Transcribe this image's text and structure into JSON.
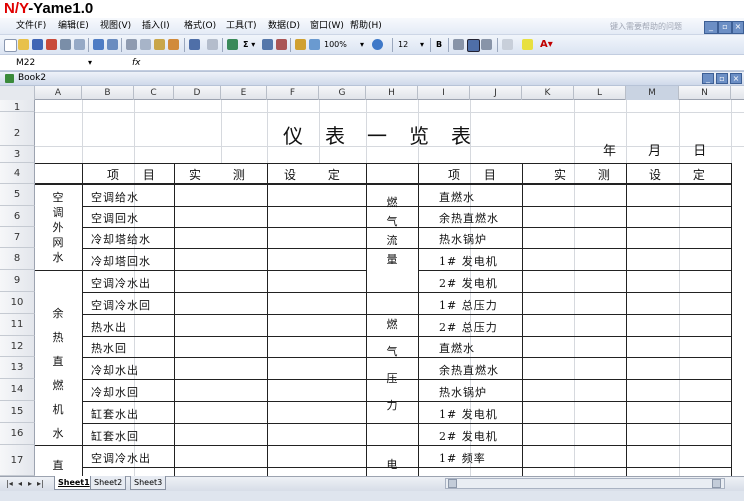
{
  "app": {
    "title_prefix": "N/Y",
    "title_suffix": "-Yame1.0"
  },
  "menu": {
    "items": [
      "文件(F)",
      "编辑(E)",
      "视图(V)",
      "插入(I)",
      "格式(O)",
      "工具(T)",
      "数据(D)",
      "窗口(W)",
      "帮助(H)"
    ],
    "help_placeholder": "键入需要帮助的问题"
  },
  "toolbar": {
    "zoom": "100%",
    "font_size": "12",
    "bold": "B"
  },
  "formula_bar": {
    "name_box": "M22",
    "fx": "fx"
  },
  "workbook": {
    "title": "Book2"
  },
  "columns": [
    "A",
    "B",
    "C",
    "D",
    "E",
    "F",
    "G",
    "H",
    "I",
    "J",
    "K",
    "L",
    "M",
    "N"
  ],
  "rows": [
    "1",
    "2",
    "3",
    "4",
    "5",
    "6",
    "7",
    "8",
    "9",
    "10",
    "11",
    "12",
    "13",
    "14",
    "15",
    "16",
    "17"
  ],
  "sheet": {
    "title": "仪表一览表",
    "date_label": "年 月 日",
    "headers": {
      "item": "项 目",
      "measured": "实 测",
      "setting": "设 定"
    },
    "left_groups": [
      {
        "label": "空调外网水",
        "items": [
          "空调给水",
          "空调回水",
          "冷却塔给水",
          "冷却塔回水"
        ]
      },
      {
        "label": "余热直燃机水",
        "items": [
          "空调冷水出",
          "空调冷水回",
          "热水出",
          "热水回",
          "冷却水出",
          "冷却水回",
          "缸套水出",
          "缸套水回"
        ]
      },
      {
        "label": "直",
        "items": [
          "空调冷水出"
        ]
      }
    ],
    "right_groups": [
      {
        "label": "燃气流量",
        "items": [
          "直燃水",
          "余热直燃水",
          "热水锅炉",
          "1# 发电机",
          "2# 发电机"
        ]
      },
      {
        "label": "燃气压力",
        "items": [
          "1# 总压力",
          "2# 总压力",
          "直燃水",
          "余热直燃水",
          "热水锅炉",
          "1# 发电机",
          "2# 发电机"
        ]
      },
      {
        "label": "电",
        "items": [
          "1# 频率"
        ]
      }
    ]
  },
  "sheet_tabs": [
    "Sheet1",
    "Sheet2",
    "Sheet3"
  ]
}
